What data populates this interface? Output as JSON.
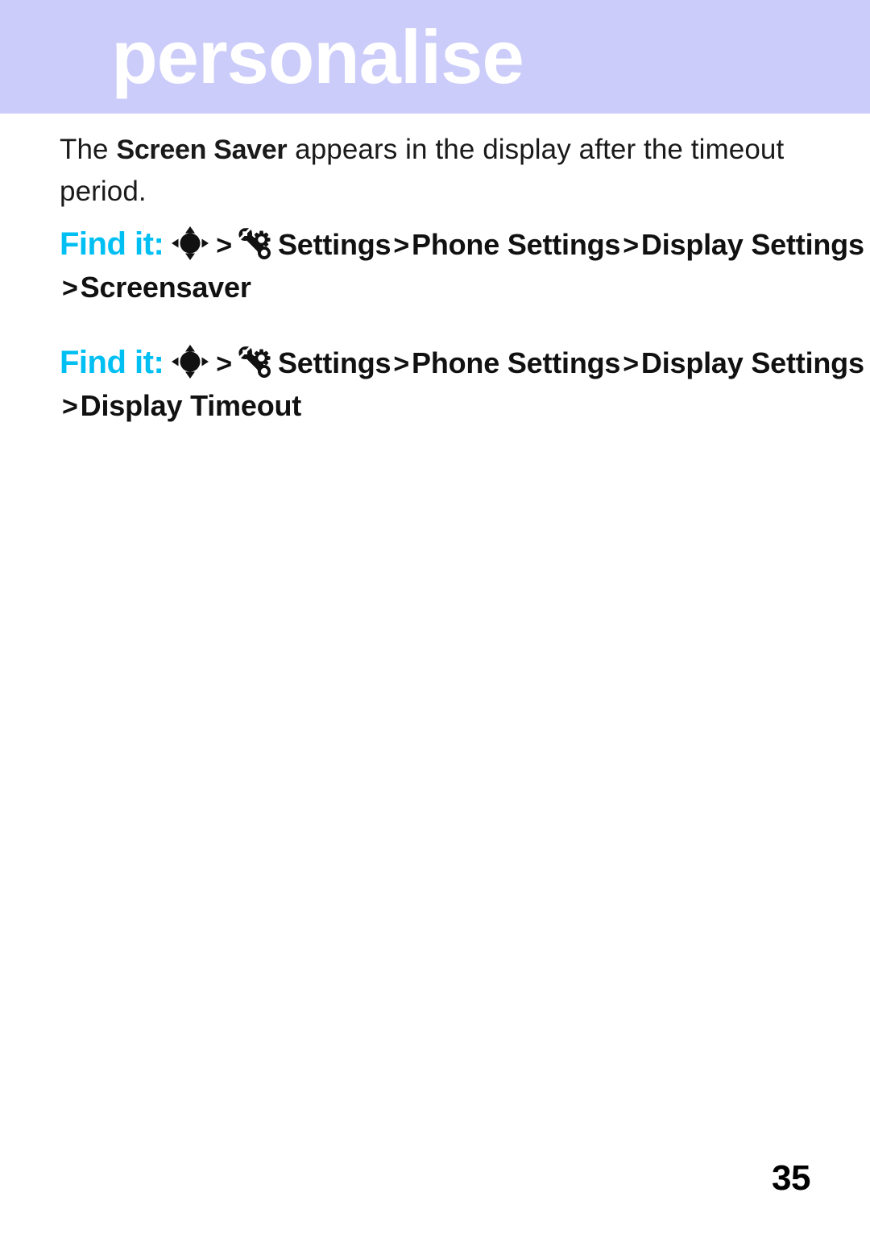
{
  "header": {
    "title": "personalise",
    "band_color": "#ccccfa",
    "title_color": "#ffffff"
  },
  "body": {
    "paragraph": {
      "before": "The ",
      "term": "Screen Saver",
      "after": " appears in the display after the timeout period."
    }
  },
  "findit_blocks": [
    {
      "label": "Find it:",
      "label_color": "#00bff3",
      "nav_icon": "dpad-navigation-icon",
      "settings_icon": "wrench-gear-settings-icon",
      "separator": ">",
      "crumbs": [
        "Settings",
        "Phone Settings",
        "Display Settings"
      ],
      "continuation_separator": ">",
      "continuation": "Screensaver"
    },
    {
      "label": "Find it:",
      "label_color": "#00bff3",
      "nav_icon": "dpad-navigation-icon",
      "settings_icon": "wrench-gear-settings-icon",
      "separator": ">",
      "crumbs": [
        "Settings",
        "Phone Settings",
        "Display Settings"
      ],
      "continuation_separator": ">",
      "continuation": "Display Timeout"
    }
  ],
  "footer": {
    "page_number": "35"
  }
}
